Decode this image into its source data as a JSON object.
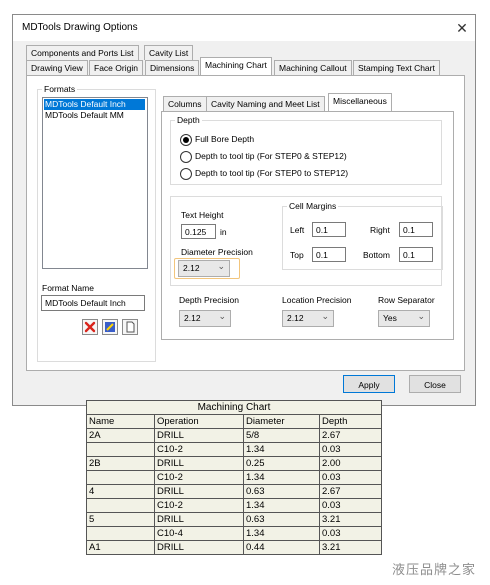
{
  "window": {
    "title": "MDTools Drawing Options"
  },
  "tabs_row1": [
    "Components and Ports List",
    "Cavity List"
  ],
  "tabs_row2": [
    "Drawing View",
    "Face Origin",
    "Dimensions",
    "Machining Chart",
    "Machining Callout",
    "Stamping Text Chart"
  ],
  "formats": {
    "label": "Formats",
    "items": [
      "MDTools Default Inch",
      "MDTools Default MM"
    ],
    "selected_index": 0,
    "name_label": "Format Name",
    "name_value": "MDTools Default Inch"
  },
  "sub_tabs": [
    "Columns",
    "Cavity Naming and Meet List",
    "Miscellaneous"
  ],
  "depth": {
    "label": "Depth",
    "options": [
      "Full Bore Depth",
      "Depth to tool tip (For STEP0 & STEP12)",
      "Depth to tool tip (For STEP0 to STEP12)"
    ],
    "selected_index": 0
  },
  "text_height": {
    "label": "Text Height",
    "value": "0.125",
    "unit": "in"
  },
  "cell_margins": {
    "label": "Cell Margins",
    "left_label": "Left",
    "left": "0.1",
    "right_label": "Right",
    "right": "0.1",
    "top_label": "Top",
    "top": "0.1",
    "bottom_label": "Bottom",
    "bottom": "0.1"
  },
  "diameter_precision": {
    "label": "Diameter Precision",
    "value": "2.12"
  },
  "depth_precision": {
    "label": "Depth Precision",
    "value": "2.12"
  },
  "location_precision": {
    "label": "Location Precision",
    "value": "2.12"
  },
  "row_separator": {
    "label": "Row Separator",
    "value": "Yes"
  },
  "buttons": {
    "apply": "Apply",
    "close": "Close"
  },
  "colors": {
    "highlight_border": "#f2c57c",
    "selection": "#0078d7"
  },
  "machining_chart": {
    "title": "Machining Chart",
    "headers": [
      "Name",
      "Operation",
      "Diameter",
      "Depth"
    ],
    "rows": [
      [
        "2A",
        "DRILL",
        "5/8",
        "2.67"
      ],
      [
        "",
        "C10-2",
        "1.34",
        "0.03"
      ],
      [
        "2B",
        "DRILL",
        "0.25",
        "2.00"
      ],
      [
        "",
        "C10-2",
        "1.34",
        "0.03"
      ],
      [
        "4",
        "DRILL",
        "0.63",
        "2.67"
      ],
      [
        "",
        "C10-2",
        "1.34",
        "0.03"
      ],
      [
        "5",
        "DRILL",
        "0.63",
        "3.21"
      ],
      [
        "",
        "C10-4",
        "1.34",
        "0.03"
      ],
      [
        "A1",
        "DRILL",
        "0.44",
        "3.21"
      ]
    ]
  },
  "watermark": "液压品牌之家"
}
